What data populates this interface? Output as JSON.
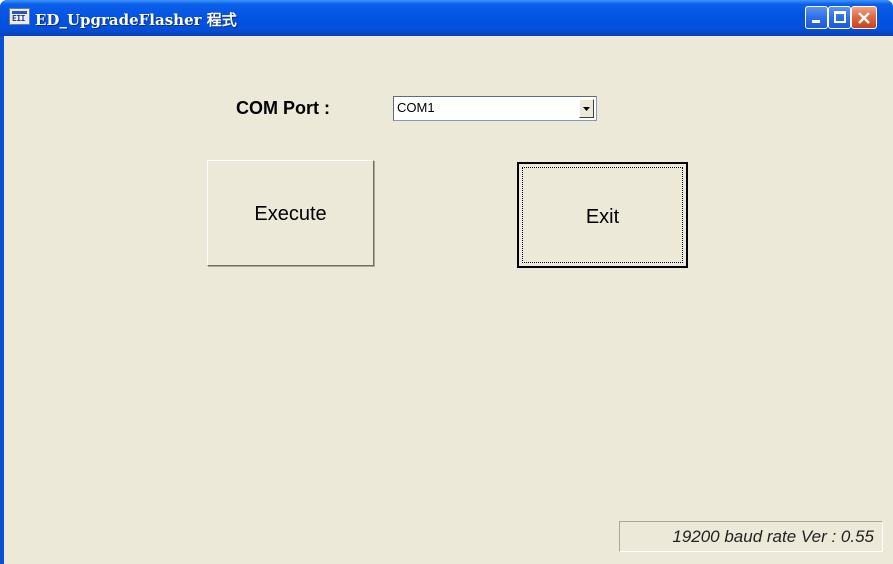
{
  "window": {
    "title": "ED_UpgradeFlasher 程式",
    "icon": "app-icon",
    "icon_text": "EII",
    "controls": [
      "minimize-icon",
      "maximize-icon",
      "close-icon"
    ]
  },
  "form": {
    "com_port_label": "COM Port :",
    "com_port_value": "COM1"
  },
  "buttons": {
    "execute_label": "Execute",
    "exit_label": "Exit"
  },
  "status": {
    "text": "19200 baud rate Ver : 0.55"
  },
  "colors": {
    "title_bar": "#0454e3",
    "client_background": "#ece9d8",
    "close_button": "#e26a45"
  }
}
